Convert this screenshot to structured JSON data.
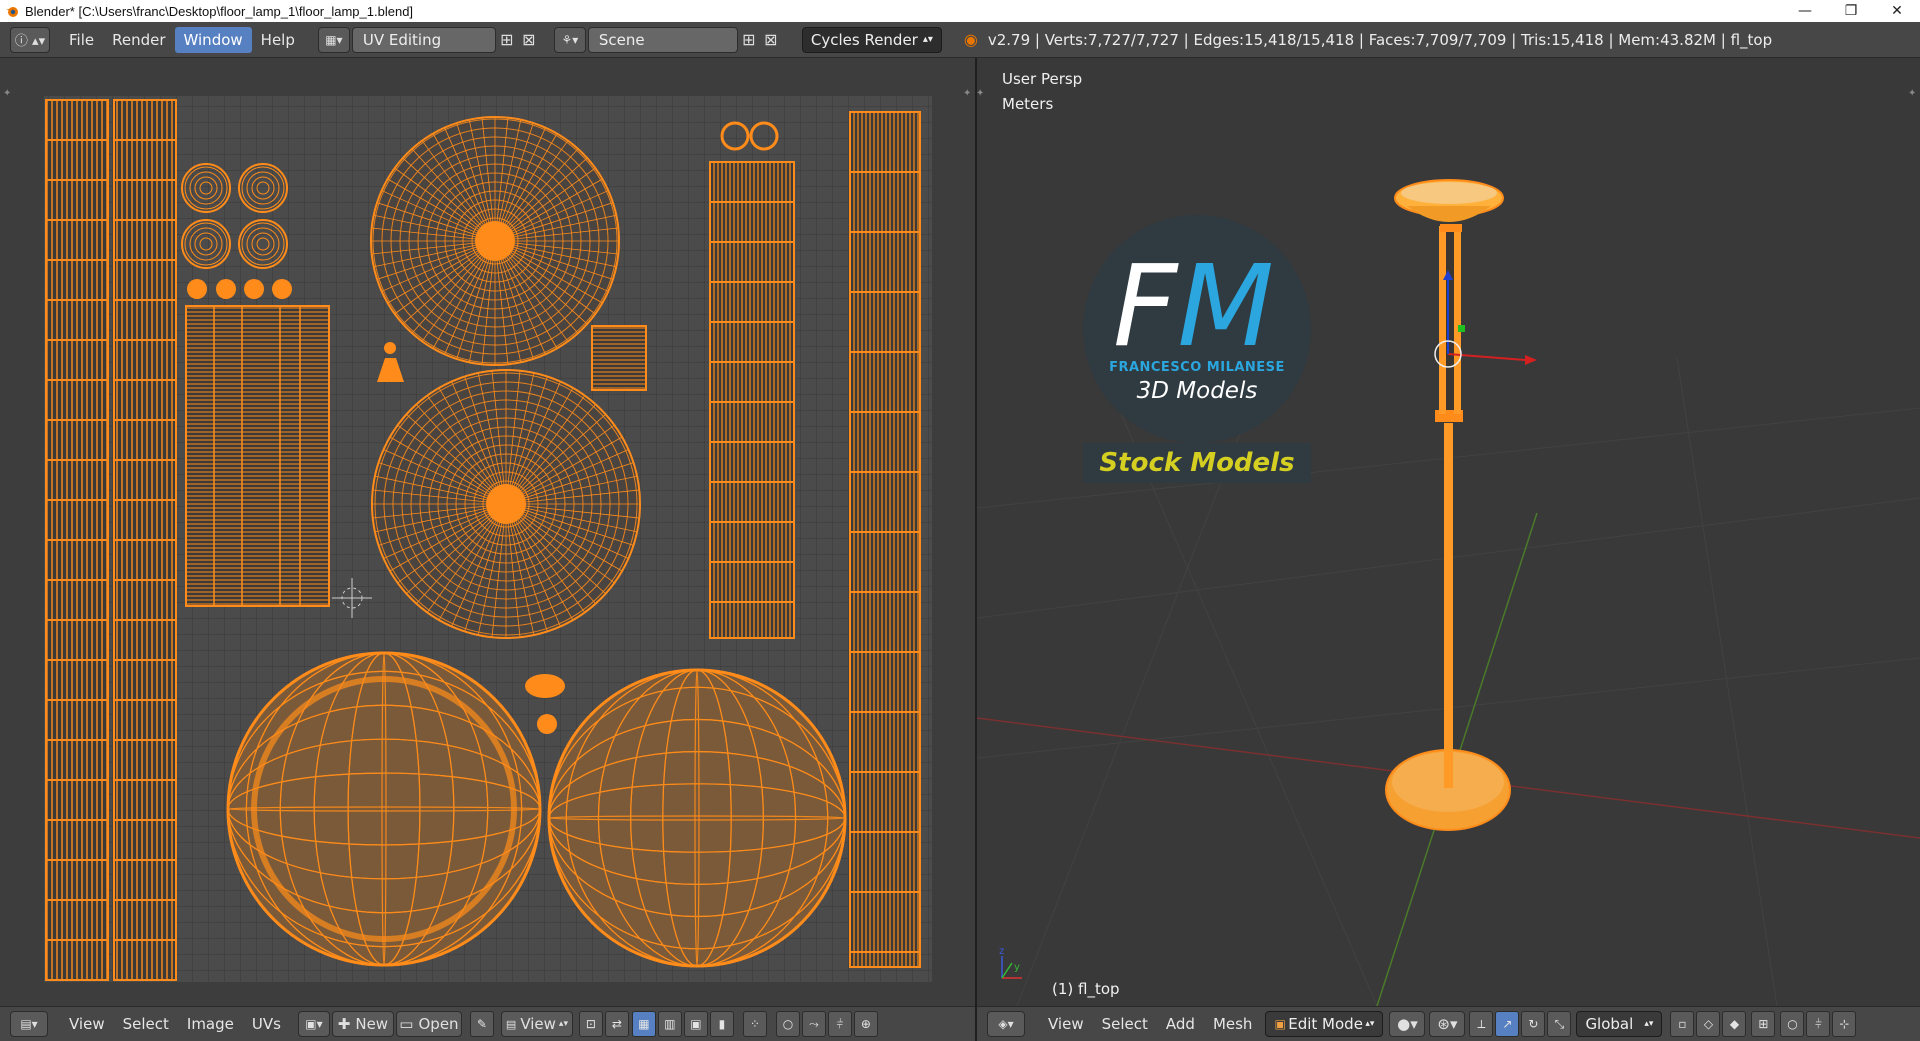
{
  "window": {
    "title": "Blender* [C:\\Users\\franc\\Desktop\\floor_lamp_1\\floor_lamp_1.blend]",
    "minimize": "—",
    "restore": "❐",
    "close": "✕"
  },
  "topbar": {
    "menus": [
      "File",
      "Render",
      "Window",
      "Help"
    ],
    "active_menu": "Window",
    "screen_layout": "UV Editing",
    "scene": "Scene",
    "render_engine": "Cycles Render",
    "stats": "v2.79 | Verts:7,727/7,727 | Edges:15,418/15,418 | Faces:7,709/7,709 | Tris:15,418 | Mem:43.82M | fl_top"
  },
  "uv_editor": {
    "header": {
      "menus": [
        "View",
        "Select",
        "Image",
        "UVs"
      ],
      "new_label": "New",
      "open_label": "Open",
      "view_label": "View"
    }
  },
  "viewport": {
    "view_name": "User Persp",
    "units": "Meters",
    "object_label": "(1) fl_top",
    "logo": {
      "initials_f": "F",
      "initials_m": "M",
      "name": "FRANCESCO MILANESE",
      "subtitle": "3D Models",
      "banner": "Stock Models"
    },
    "header": {
      "menus": [
        "View",
        "Select",
        "Add",
        "Mesh"
      ],
      "mode": "Edit Mode",
      "orientation": "Global"
    }
  },
  "colors": {
    "uv_orange": "#ff8c1a",
    "active_blue": "#5680c2",
    "logo_cyan": "#2ba6de",
    "banner_yellow": "#d4cf21"
  }
}
